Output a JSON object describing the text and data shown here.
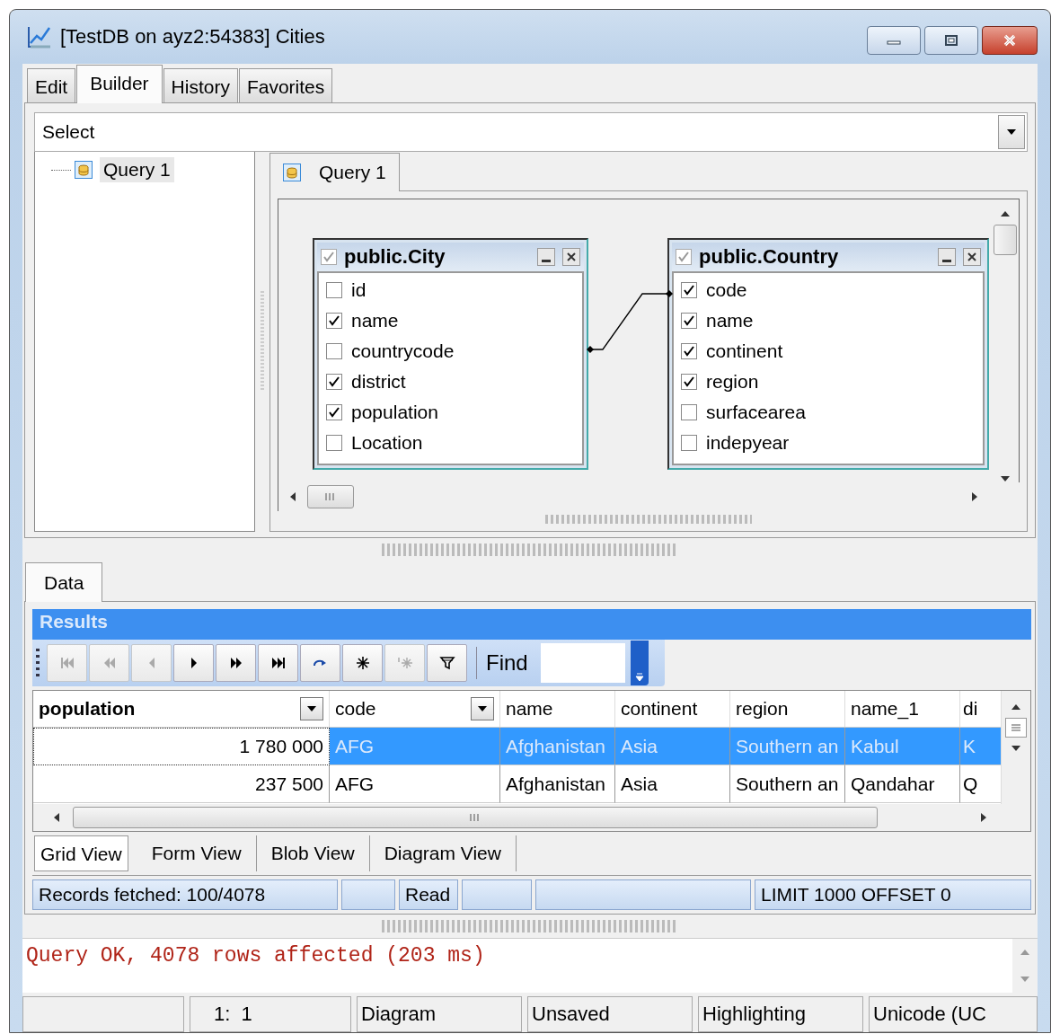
{
  "window": {
    "title": "[TestDB on ayz2:54383] Cities"
  },
  "editor_tabs": [
    {
      "label": "Edit",
      "selected": false
    },
    {
      "label": "Builder",
      "selected": true
    },
    {
      "label": "History",
      "selected": false
    },
    {
      "label": "Favorites",
      "selected": false
    }
  ],
  "query_type": {
    "value": "Select"
  },
  "query_tree": [
    {
      "label": "Query 1",
      "selected": true
    }
  ],
  "diagram_tabs": [
    {
      "label": "Query 1",
      "selected": true
    }
  ],
  "tables": [
    {
      "title": "public.City",
      "checked": true,
      "fields": [
        {
          "name": "id",
          "checked": false
        },
        {
          "name": "name",
          "checked": true
        },
        {
          "name": "countrycode",
          "checked": false
        },
        {
          "name": "district",
          "checked": true
        },
        {
          "name": "population",
          "checked": true
        },
        {
          "name": "Location",
          "checked": false
        }
      ]
    },
    {
      "title": "public.Country",
      "checked": true,
      "fields": [
        {
          "name": "code",
          "checked": true
        },
        {
          "name": "name",
          "checked": true
        },
        {
          "name": "continent",
          "checked": true
        },
        {
          "name": "region",
          "checked": true
        },
        {
          "name": "surfacearea",
          "checked": false
        },
        {
          "name": "indepyear",
          "checked": false
        }
      ]
    }
  ],
  "data_tabs": [
    {
      "label": "Data",
      "selected": true
    }
  ],
  "results": {
    "title": "Results",
    "find_label": "Find",
    "toolbar": [
      {
        "kind": "first",
        "disabled": true
      },
      {
        "kind": "prior-page",
        "disabled": true
      },
      {
        "kind": "prior",
        "disabled": true
      },
      {
        "kind": "next",
        "disabled": false
      },
      {
        "kind": "next-page",
        "disabled": false
      },
      {
        "kind": "last",
        "disabled": false
      },
      {
        "kind": "refresh",
        "disabled": false
      },
      {
        "kind": "insert",
        "disabled": false
      },
      {
        "kind": "clear",
        "disabled": true
      },
      {
        "kind": "filter",
        "disabled": false
      }
    ]
  },
  "grid": {
    "columns": [
      {
        "label": "population",
        "filter": true
      },
      {
        "label": "code",
        "filter": true
      },
      {
        "label": "name",
        "filter": false
      },
      {
        "label": "continent",
        "filter": false
      },
      {
        "label": "region",
        "filter": false
      },
      {
        "label": "name_1",
        "filter": false
      },
      {
        "label": "di",
        "filter": false
      }
    ],
    "rows": [
      {
        "selected": true,
        "cells": [
          "1 780 000",
          "AFG",
          "Afghanistan",
          "Asia",
          "Southern an",
          "Kabul",
          "K"
        ]
      },
      {
        "selected": false,
        "cells": [
          "237 500",
          "AFG",
          "Afghanistan",
          "Asia",
          "Southern an",
          "Qandahar",
          "Q"
        ]
      }
    ]
  },
  "view_tabs": [
    {
      "label": "Grid View",
      "selected": true
    },
    {
      "label": "Form View",
      "selected": false
    },
    {
      "label": "Blob View",
      "selected": false
    },
    {
      "label": "Diagram View",
      "selected": false
    }
  ],
  "grid_status": {
    "records": "Records fetched: 100/4078",
    "mode": "Read",
    "limit": "LIMIT 1000 OFFSET 0"
  },
  "message": "Query OK, 4078 rows affected (203 ms)",
  "status_bar": {
    "cursor": "1:  1",
    "view": "Diagram",
    "save_state": "Unsaved",
    "highlighting": "Highlighting",
    "encoding": "Unicode (UC"
  }
}
